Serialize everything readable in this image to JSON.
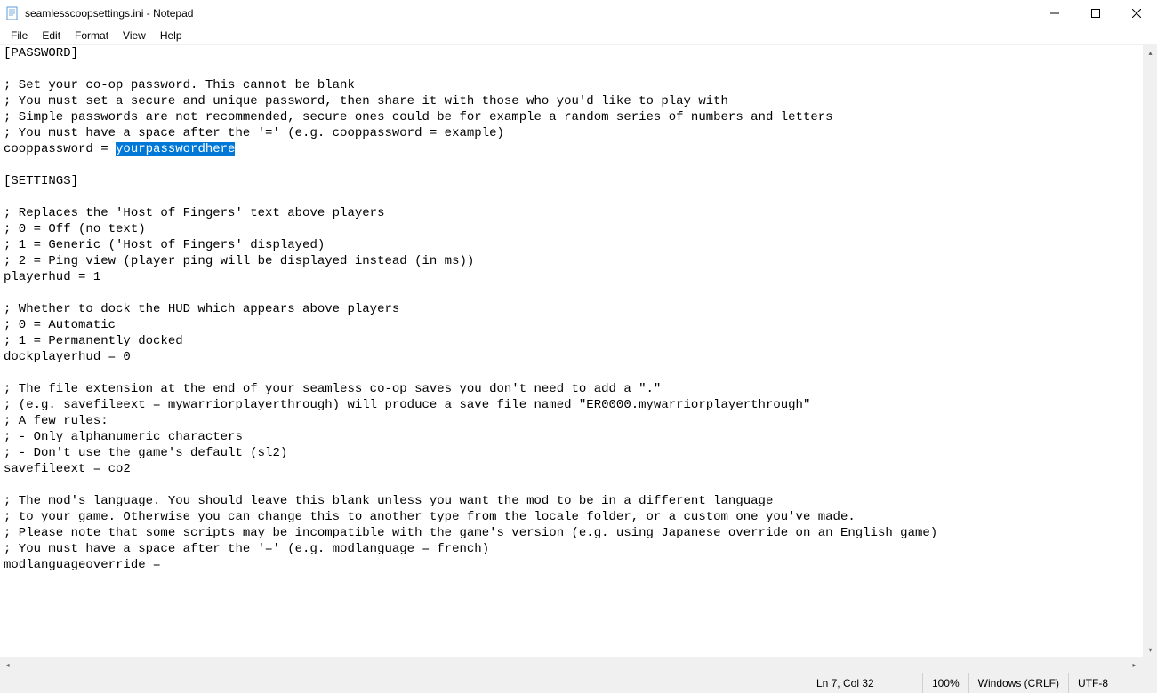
{
  "titlebar": {
    "title": "seamlesscoopsettings.ini - Notepad"
  },
  "menubar": {
    "items": [
      "File",
      "Edit",
      "Format",
      "View",
      "Help"
    ]
  },
  "editor": {
    "lines": [
      "[PASSWORD]",
      "",
      "; Set your co-op password. This cannot be blank",
      "; You must set a secure and unique password, then share it with those who you'd like to play with",
      "; Simple passwords are not recommended, secure ones could be for example a random series of numbers and letters",
      "; You must have a space after the '=' (e.g. cooppassword = example)"
    ],
    "passwordLinePrefix": "cooppassword = ",
    "passwordSelected": "yourpasswordhere",
    "linesAfter": [
      "",
      "[SETTINGS]",
      "",
      "; Replaces the 'Host of Fingers' text above players",
      "; 0 = Off (no text)",
      "; 1 = Generic ('Host of Fingers' displayed)",
      "; 2 = Ping view (player ping will be displayed instead (in ms))",
      "playerhud = 1",
      "",
      "; Whether to dock the HUD which appears above players",
      "; 0 = Automatic",
      "; 1 = Permanently docked",
      "dockplayerhud = 0",
      "",
      "; The file extension at the end of your seamless co-op saves you don't need to add a \".\"",
      "; (e.g. savefileext = mywarriorplayerthrough) will produce a save file named \"ER0000.mywarriorplayerthrough\"",
      "; A few rules:",
      "; - Only alphanumeric characters",
      "; - Don't use the game's default (sl2)",
      "savefileext = co2",
      "",
      "; The mod's language. You should leave this blank unless you want the mod to be in a different language",
      "; to your game. Otherwise you can change this to another type from the locale folder, or a custom one you've made.",
      "; Please note that some scripts may be incompatible with the game's version (e.g. using Japanese override on an English game)",
      "; You must have a space after the '=' (e.g. modlanguage = french)",
      "modlanguageoverride = "
    ]
  },
  "statusbar": {
    "position": "Ln 7, Col 32",
    "zoom": "100%",
    "eol": "Windows (CRLF)",
    "encoding": "UTF-8"
  }
}
